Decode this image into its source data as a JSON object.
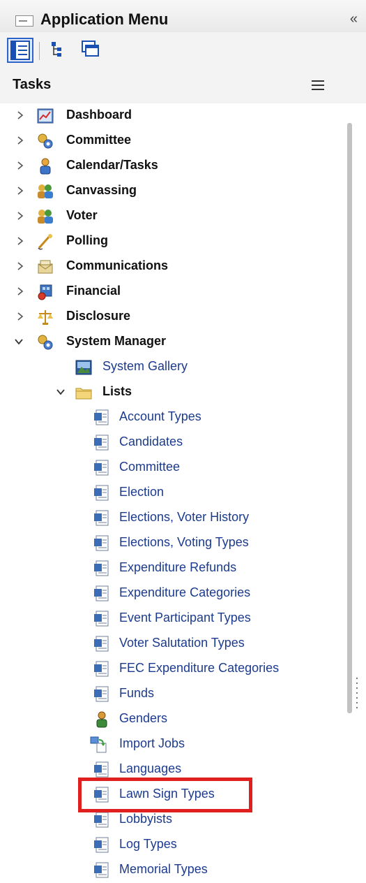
{
  "header": {
    "title": "Application Menu",
    "collapse_glyph": "«"
  },
  "toolbar": {
    "buttons": [
      {
        "icon": "list-view-icon",
        "active": true
      },
      {
        "icon": "tree-view-icon",
        "active": false
      },
      {
        "icon": "window-view-icon",
        "active": false
      }
    ]
  },
  "tasks": {
    "label": "Tasks",
    "menu_icon": "hamburger-icon"
  },
  "tree": {
    "top_level": [
      {
        "label": "Dashboard",
        "icon": "dashboard-icon",
        "expanded": false
      },
      {
        "label": "Committee",
        "icon": "committee-icon",
        "expanded": false
      },
      {
        "label": "Calendar/Tasks",
        "icon": "calendar-person-icon",
        "expanded": false
      },
      {
        "label": "Canvassing",
        "icon": "canvassing-icon",
        "expanded": false
      },
      {
        "label": "Voter",
        "icon": "voter-icon",
        "expanded": false
      },
      {
        "label": "Polling",
        "icon": "polling-icon",
        "expanded": false
      },
      {
        "label": "Communications",
        "icon": "communications-icon",
        "expanded": false
      },
      {
        "label": "Financial",
        "icon": "financial-icon",
        "expanded": false
      },
      {
        "label": "Disclosure",
        "icon": "disclosure-icon",
        "expanded": false
      },
      {
        "label": "System Manager",
        "icon": "system-manager-icon",
        "expanded": true
      }
    ],
    "system_manager_children": {
      "gallery": {
        "label": "System Gallery",
        "icon": "gallery-icon"
      },
      "lists": {
        "label": "Lists",
        "icon": "folder-icon",
        "expanded": true
      }
    },
    "list_items": [
      {
        "label": "Account Types",
        "icon": "list-doc-icon"
      },
      {
        "label": "Candidates",
        "icon": "list-doc-icon"
      },
      {
        "label": "Committee",
        "icon": "list-doc-icon"
      },
      {
        "label": "Election",
        "icon": "list-doc-icon"
      },
      {
        "label": "Elections, Voter History",
        "icon": "list-doc-icon"
      },
      {
        "label": "Elections, Voting Types",
        "icon": "list-doc-icon"
      },
      {
        "label": "Expenditure Refunds",
        "icon": "list-doc-icon"
      },
      {
        "label": "Expenditure Categories",
        "icon": "list-doc-icon"
      },
      {
        "label": "Event Participant Types",
        "icon": "list-doc-icon"
      },
      {
        "label": "Voter Salutation Types",
        "icon": "list-doc-icon"
      },
      {
        "label": "FEC Expenditure Categories",
        "icon": "list-doc-icon"
      },
      {
        "label": "Funds",
        "icon": "list-doc-icon"
      },
      {
        "label": "Genders",
        "icon": "person-icon"
      },
      {
        "label": "Import Jobs",
        "icon": "import-icon"
      },
      {
        "label": "Languages",
        "icon": "list-doc-icon"
      },
      {
        "label": "Lawn Sign Types",
        "icon": "list-doc-icon",
        "highlighted": true
      },
      {
        "label": "Lobbyists",
        "icon": "list-doc-icon"
      },
      {
        "label": "Log Types",
        "icon": "list-doc-icon"
      },
      {
        "label": "Memorial Types",
        "icon": "list-doc-icon"
      }
    ]
  },
  "colors": {
    "link": "#1c3b8e",
    "highlight": "#e01f1f",
    "active_toolbar": "#2c64c9"
  }
}
